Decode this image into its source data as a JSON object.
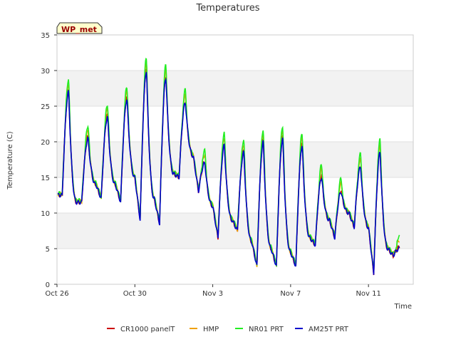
{
  "chart_data": {
    "type": "line",
    "title": "Temperatures",
    "xlabel": "Time",
    "ylabel": "Temperature (C)",
    "station_label": "WP_met",
    "ylim": [
      0,
      35
    ],
    "yticks": [
      0,
      5,
      10,
      15,
      20,
      25,
      30,
      35
    ],
    "xlim_days": [
      0,
      18.3
    ],
    "xticks": [
      {
        "day": 0,
        "label": "Oct 26"
      },
      {
        "day": 4,
        "label": "Oct 30"
      },
      {
        "day": 8,
        "label": "Nov 3"
      },
      {
        "day": 12,
        "label": "Nov 7"
      },
      {
        "day": 16,
        "label": "Nov 11"
      }
    ],
    "grid": "horizontal bands",
    "legend_position": "bottom",
    "series": [
      {
        "name": "CR1000 panelT",
        "color": "#cc0000",
        "offset": 0.1
      },
      {
        "name": "HMP",
        "color": "#f0a000",
        "offset": 0.6
      },
      {
        "name": "NR01 PRT",
        "color": "#22ee22",
        "offset": 0.9
      },
      {
        "name": "AM25T PRT",
        "color": "#0000cc",
        "offset": 0.0
      }
    ],
    "daily_profile": [
      {
        "min": 12.5,
        "max": 27.0,
        "next_start": 11.5
      },
      {
        "min": 11.5,
        "max": 20.5,
        "next_start": 14.0
      },
      {
        "min": 12.0,
        "max": 23.5,
        "next_start": 14.0
      },
      {
        "min": 11.5,
        "max": 26.0,
        "next_start": 15.0
      },
      {
        "min": 9.0,
        "max": 30.0,
        "next_start": 12.0
      },
      {
        "min": 8.5,
        "max": 29.0,
        "next_start": 15.5
      },
      {
        "min": 15.0,
        "max": 25.5,
        "next_start": 18.0
      },
      {
        "min": 13.0,
        "max": 17.0,
        "next_start": 11.0
      },
      {
        "min": 6.5,
        "max": 19.5,
        "next_start": 9.0
      },
      {
        "min": 7.5,
        "max": 18.5,
        "next_start": 6.0
      },
      {
        "min": 2.5,
        "max": 20.0,
        "next_start": 5.0
      },
      {
        "min": 2.5,
        "max": 20.5,
        "next_start": 4.5
      },
      {
        "min": 2.5,
        "max": 19.5,
        "next_start": 6.5
      },
      {
        "min": 5.5,
        "max": 15.0,
        "next_start": 9.0
      },
      {
        "min": 6.5,
        "max": 13.0,
        "next_start": 10.0
      },
      {
        "min": 8.0,
        "max": 16.5,
        "next_start": 8.0
      },
      {
        "min": 1.5,
        "max": 18.5,
        "next_start": 5.0
      },
      {
        "min": 4.0,
        "max": 5.0,
        "next_start": 3.0
      }
    ]
  }
}
